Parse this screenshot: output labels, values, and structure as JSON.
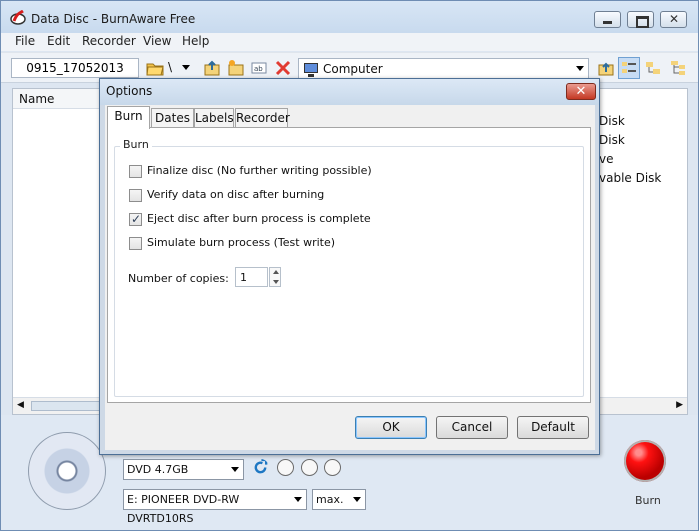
{
  "window": {
    "title": "Data Disc - BurnAware Free",
    "title_icon": "burnaware-logo-icon",
    "colors": {
      "title_bar": "#d8e6f5",
      "window_bg": "#dde6f1",
      "burn_red": "#ff1111"
    }
  },
  "menu": [
    "File",
    "Edit",
    "Recorder",
    "View",
    "Help"
  ],
  "toolbar": {
    "disc_label": "0915_17052013",
    "path": "\\",
    "location": "Computer"
  },
  "left_pane": {
    "header": "Name"
  },
  "right_pane": {
    "items": [
      "Disk",
      "Disk",
      "ve",
      "vable Disk"
    ]
  },
  "bottom": {
    "disc_type": "DVD 4.7GB",
    "recorder": "E: PIONEER DVD-RW DVRTD10RS",
    "speed": "max.",
    "burn_label": "Burn"
  },
  "dialog": {
    "title": "Options",
    "tabs": [
      "Burn",
      "Dates",
      "Labels",
      "Recorder"
    ],
    "group_title": "Burn",
    "options": [
      {
        "label": "Finalize disc (No further writing possible)",
        "checked": false
      },
      {
        "label": "Verify data on disc after burning",
        "checked": false
      },
      {
        "label": "Eject disc after burn process is complete",
        "checked": true
      },
      {
        "label": "Simulate burn process (Test write)",
        "checked": false
      }
    ],
    "copies_label": "Number of copies:",
    "copies_value": "1",
    "buttons": {
      "ok": "OK",
      "cancel": "Cancel",
      "default": "Default"
    }
  }
}
